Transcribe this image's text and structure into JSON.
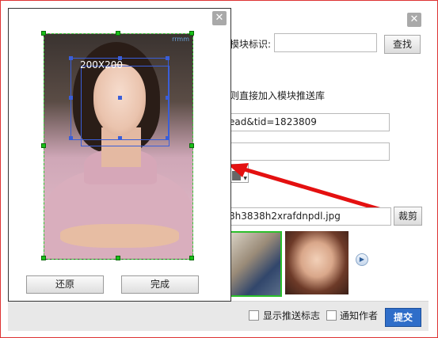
{
  "background_dialog": {
    "close_label": "✕",
    "module_id_label": "模块标识:",
    "module_id_value": "",
    "find_button": "查找",
    "direct_add_text": "则直接加入模块推送库",
    "url_value": "ead&tid=1823809",
    "empty_field_value": "",
    "file_value": "8h3838h2xrafdnpdl.jpg",
    "crop_button": "裁剪",
    "next_icon": "▶",
    "show_push_mark_label": "显示推送标志",
    "notify_author_label": "通知作者",
    "submit_button": "提交",
    "accent_color": "#2f6ec9",
    "arrow_color": "#e41010"
  },
  "crop_dialog": {
    "close_label": "✕",
    "selection_size_label": "200X200",
    "photo_logo": "rrmm",
    "reset_button": "还原",
    "done_button": "完成",
    "selection_color": "#3a5ed8",
    "handle_color": "#18c018"
  }
}
